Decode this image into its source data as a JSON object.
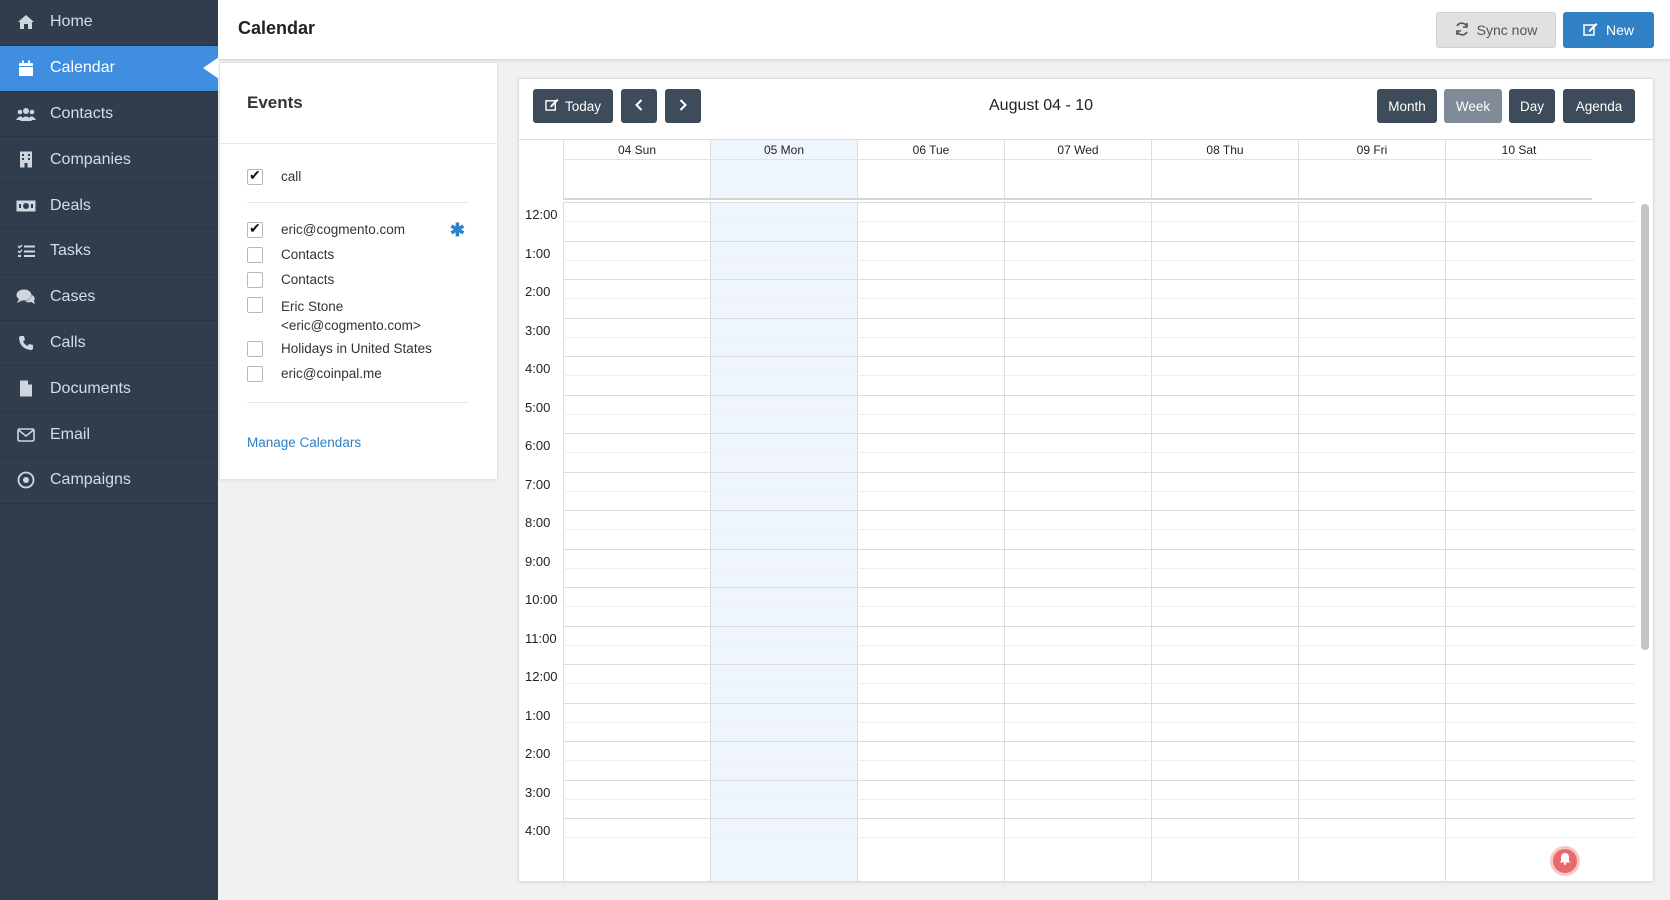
{
  "sidebar": {
    "items": [
      {
        "label": "Home",
        "icon": "home-icon"
      },
      {
        "label": "Calendar",
        "icon": "calendar-icon",
        "active": true
      },
      {
        "label": "Contacts",
        "icon": "users-icon"
      },
      {
        "label": "Companies",
        "icon": "building-icon"
      },
      {
        "label": "Deals",
        "icon": "money-icon"
      },
      {
        "label": "Tasks",
        "icon": "tasks-icon"
      },
      {
        "label": "Cases",
        "icon": "comments-icon"
      },
      {
        "label": "Calls",
        "icon": "phone-icon"
      },
      {
        "label": "Documents",
        "icon": "file-icon"
      },
      {
        "label": "Email",
        "icon": "envelope-icon"
      },
      {
        "label": "Campaigns",
        "icon": "target-icon"
      }
    ]
  },
  "header": {
    "title": "Calendar",
    "sync_label": "Sync now",
    "new_label": "New"
  },
  "events": {
    "title": "Events",
    "group1": [
      {
        "label": "call",
        "checked": true
      }
    ],
    "group2": [
      {
        "label": "eric@cogmento.com",
        "checked": true
      },
      {
        "label": "Contacts",
        "checked": false
      },
      {
        "label": "Contacts",
        "checked": false
      },
      {
        "label": "Eric Stone <eric@cogmento.com>",
        "checked": false
      },
      {
        "label": "Holidays in United States",
        "checked": false
      },
      {
        "label": "eric@coinpal.me",
        "checked": false
      }
    ],
    "manage_label": "Manage Calendars"
  },
  "calendar": {
    "today_label": "Today",
    "range_label": "August 04 - 10",
    "views": [
      "Month",
      "Week",
      "Day",
      "Agenda"
    ],
    "selected_view": "Week",
    "days": [
      "04 Sun",
      "05 Mon",
      "06 Tue",
      "07 Wed",
      "08 Thu",
      "09 Fri",
      "10 Sat"
    ],
    "today_index": 1,
    "hours": [
      "12:00",
      "1:00",
      "2:00",
      "3:00",
      "4:00",
      "5:00",
      "6:00",
      "7:00",
      "8:00",
      "9:00",
      "10:00",
      "11:00",
      "12:00",
      "1:00",
      "2:00",
      "3:00",
      "4:00"
    ]
  },
  "colors": {
    "sidebar_bg": "#2f3d4d",
    "active_nav": "#3f8ee0",
    "primary_button": "#2f80c4",
    "today_column": "#eef5fd",
    "dark_button": "#3d4b5a"
  }
}
